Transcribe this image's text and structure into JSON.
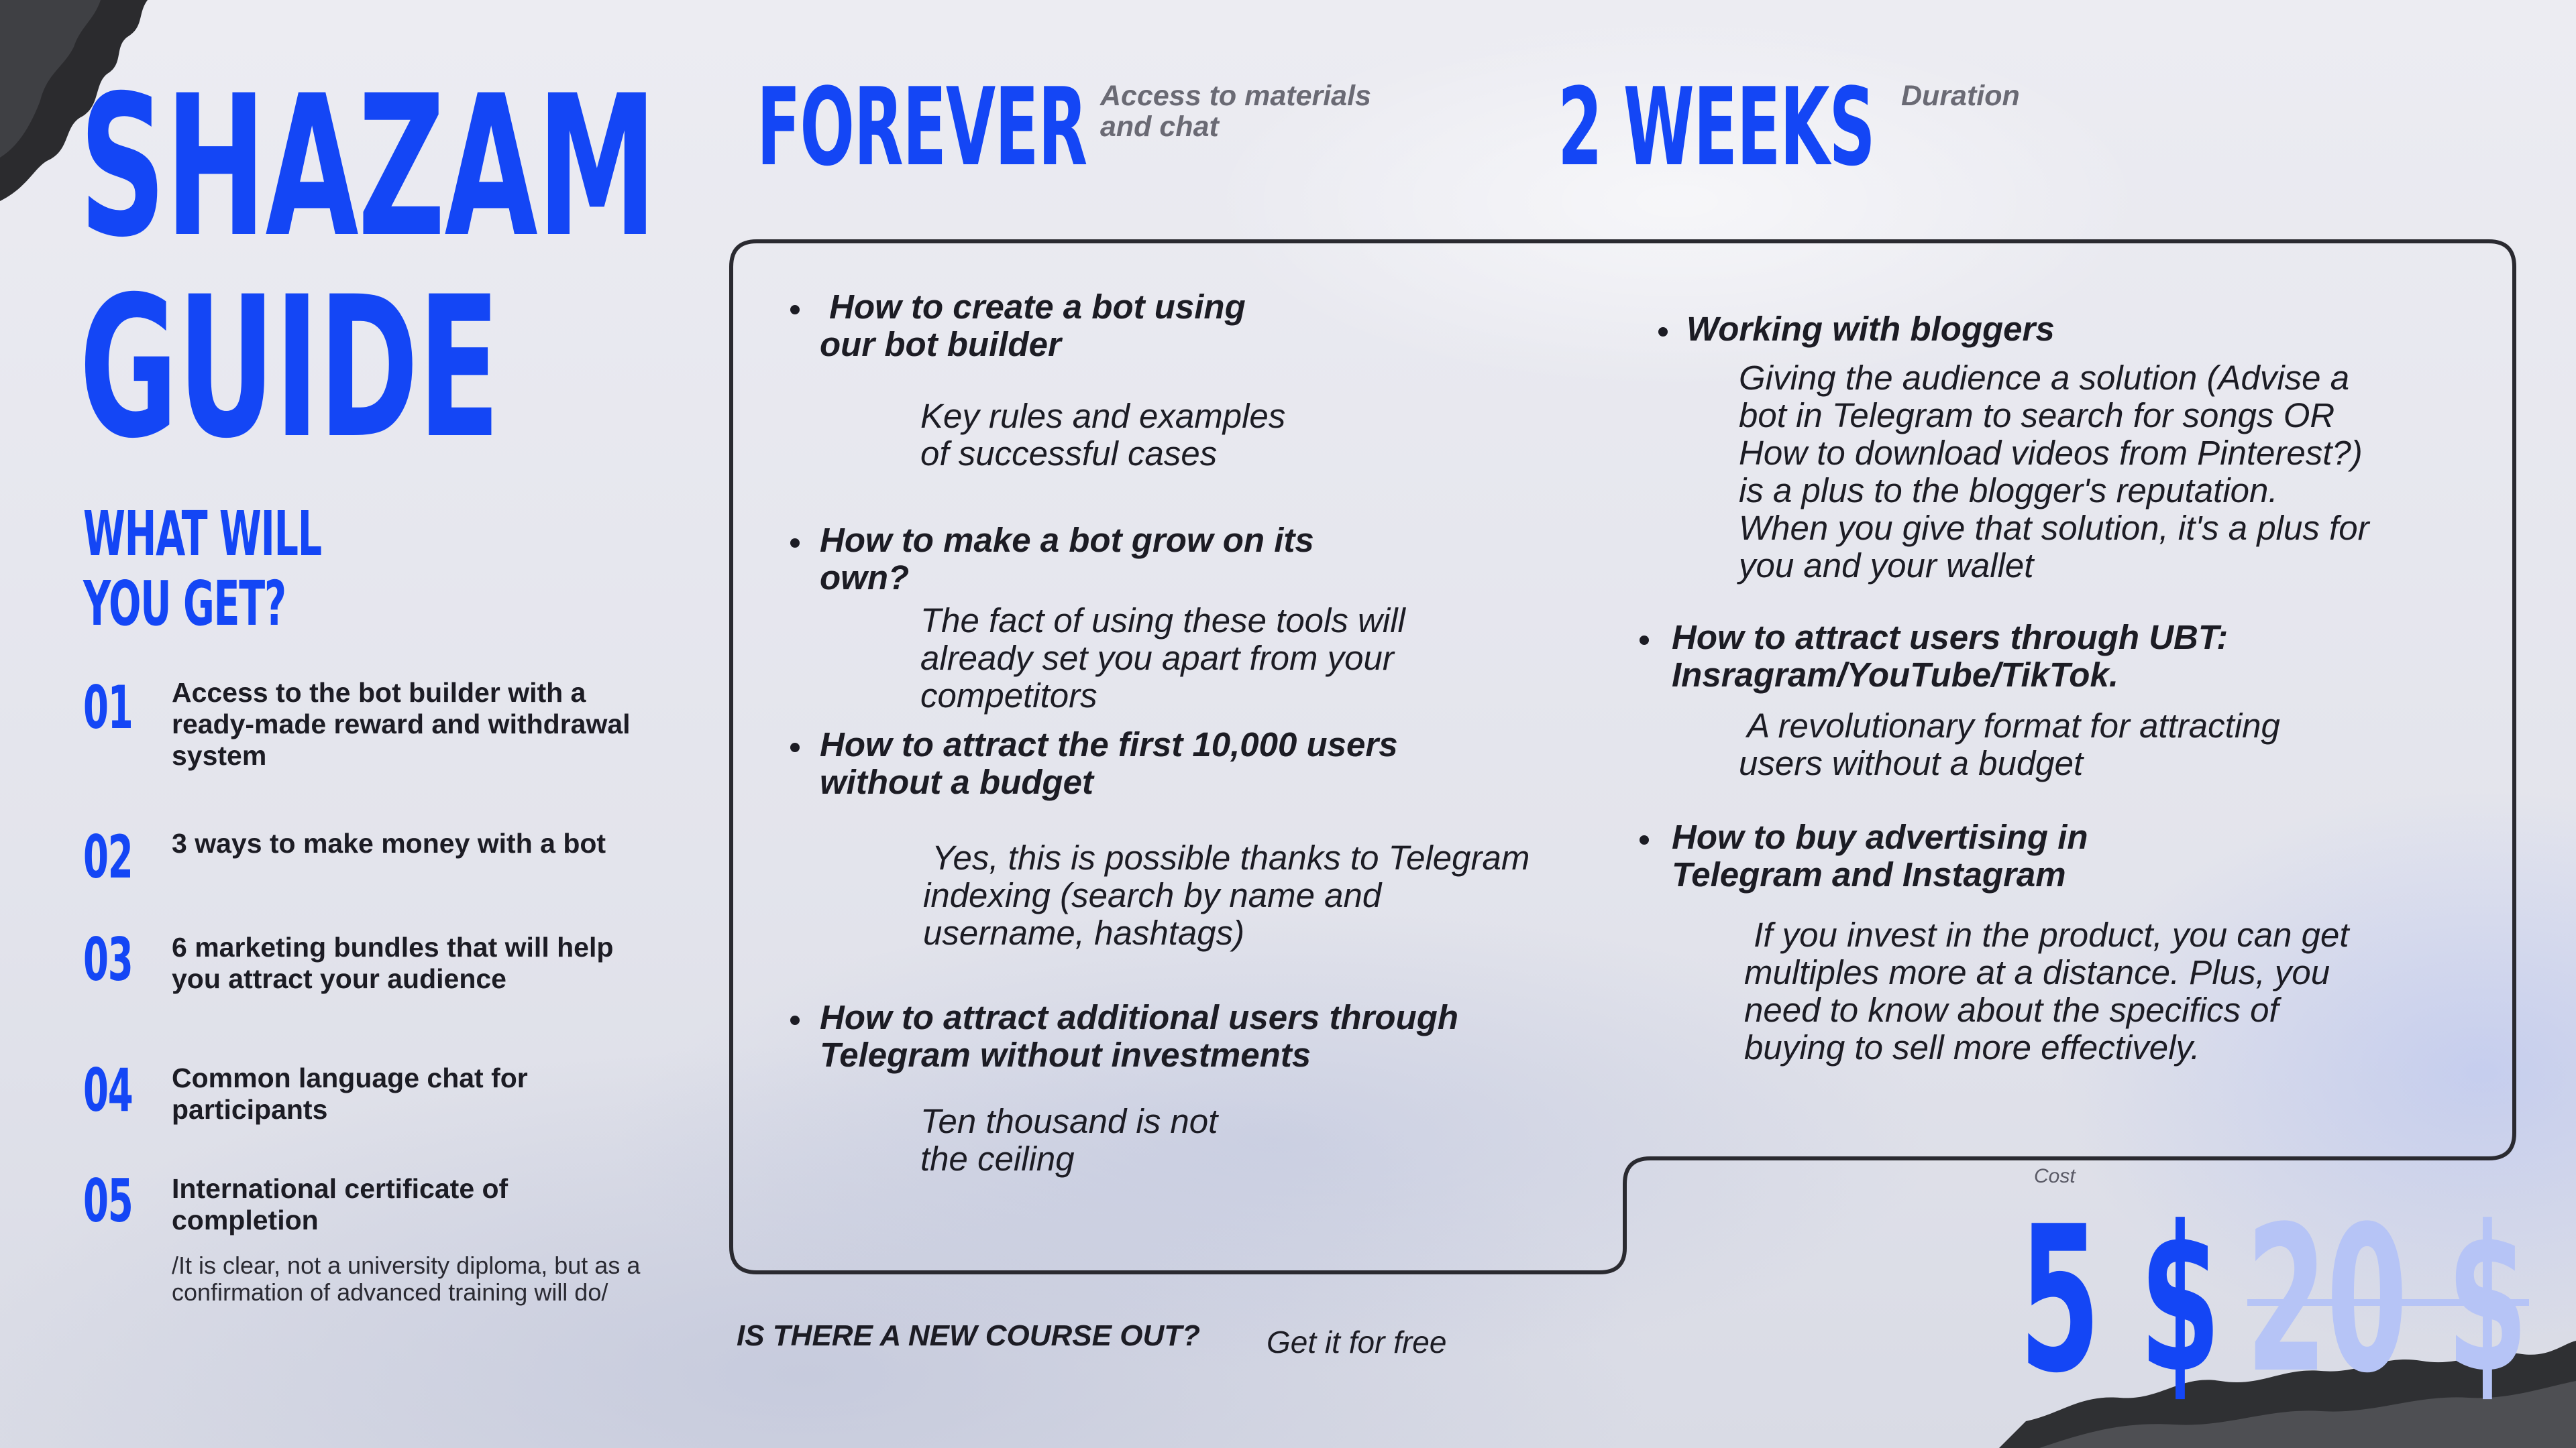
{
  "title": {
    "line1": "SHAZAM",
    "line2": "GUIDE"
  },
  "what_you_get": {
    "line1": "WHAT WILL",
    "line2": "YOU GET?"
  },
  "benefits": [
    {
      "num": "01",
      "text": "Access to the bot builder with a ready-made reward and withdrawal system"
    },
    {
      "num": "02",
      "text": "3 ways to make money with a bot"
    },
    {
      "num": "03",
      "text": "6 marketing bundles that will help you attract your audience"
    },
    {
      "num": "04",
      "text": "Common language chat for participants"
    },
    {
      "num": "05",
      "text": "International certificate of completion"
    }
  ],
  "certificate_note": "/It is clear, not a university diploma, but as a confirmation of advanced training will do/",
  "header": {
    "access": {
      "value": "FOREVER",
      "label_line1": "Access to materials",
      "label_line2": "and chat"
    },
    "duration": {
      "value": "2 WEEKS",
      "label": "Duration"
    }
  },
  "curriculum_left": [
    {
      "title_line1": " How to create a bot using",
      "title_line2": "our bot builder",
      "desc_line1": "Key rules and examples",
      "desc_line2": "of successful cases"
    },
    {
      "title_line1": "How to make a bot grow on its",
      "title_line2": "own?",
      "desc_line1": "The fact of using these tools will",
      "desc_line2": "already set you apart from your",
      "desc_line3": "competitors"
    },
    {
      "title_line1": "How to attract the first 10,000 users",
      "title_line2": "without a budget",
      "desc_line1": " Yes, this is possible thanks to Telegram",
      "desc_line2": "indexing (search by name and",
      "desc_line3": "username, hashtags)"
    },
    {
      "title_line1": "How to attract additional users through",
      "title_line2": "Telegram without investments",
      "desc_line1": "Ten thousand is not",
      "desc_line2": "the ceiling"
    }
  ],
  "curriculum_right": [
    {
      "title_line1": "Working with bloggers",
      "desc_lines": [
        "Giving the audience a solution (Advise a",
        "bot in Telegram to search for songs OR",
        "How to download videos from Pinterest?)",
        "is a plus to the blogger's reputation.",
        "When you give that solution, it's a plus for",
        "you and your wallet"
      ]
    },
    {
      "title_line1": "How to attract users through UBT:",
      "title_line2": "Insragram/YouTube/TikTok.",
      "desc_lines": [
        " A revolutionary format for attracting",
        "users without a budget"
      ]
    },
    {
      "title_line1": "How to buy advertising in",
      "title_line2": "Telegram and Instagram",
      "desc_lines": [
        " If you invest in the product, you can get",
        "multiples more at a distance. Plus, you",
        "need to know about the specifics of",
        "buying to sell more effectively."
      ]
    }
  ],
  "footer": {
    "question": "IS THERE A NEW COURSE OUT?",
    "answer": "Get it for free"
  },
  "pricing": {
    "label": "Cost",
    "current": "5 $",
    "original": "20 $"
  },
  "colors": {
    "accent": "#1446f5",
    "accent_faded": "#b6c4f6",
    "text": "#1c1c24",
    "muted": "#6a6a74"
  }
}
